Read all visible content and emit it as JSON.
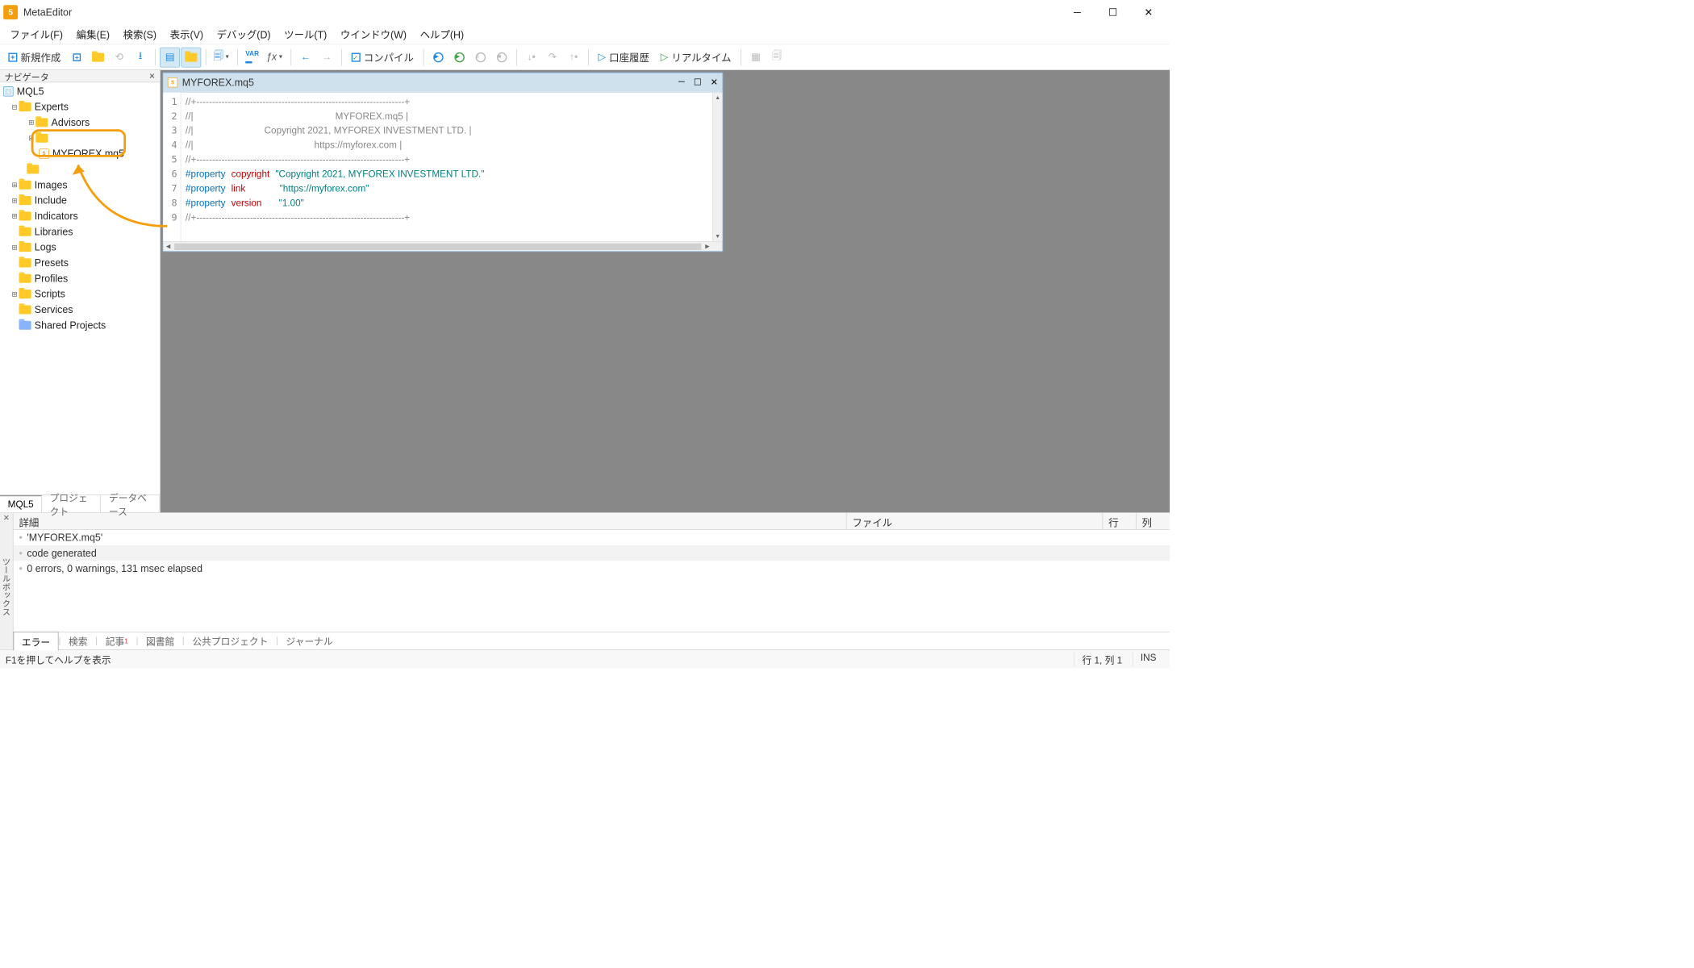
{
  "title": "MetaEditor",
  "menu": [
    "ファイル(F)",
    "編集(E)",
    "検索(S)",
    "表示(V)",
    "デバッグ(D)",
    "ツール(T)",
    "ウインドウ(W)",
    "ヘルプ(H)"
  ],
  "toolbar": {
    "new": "新規作成",
    "compile": "コンパイル",
    "history": "口座履歴",
    "realtime": "リアルタイム"
  },
  "navigator": {
    "title": "ナビゲータ",
    "root": "MQL5",
    "nodes": {
      "experts": "Experts",
      "advisors": "Advisors",
      "highlighted_file": "MYFOREX.mq5",
      "images": "Images",
      "include": "Include",
      "indicators": "Indicators",
      "libraries": "Libraries",
      "logs": "Logs",
      "presets": "Presets",
      "profiles": "Profiles",
      "scripts": "Scripts",
      "services": "Services",
      "shared": "Shared Projects"
    },
    "tabs": [
      "MQL5",
      "プロジェクト",
      "データベース"
    ]
  },
  "editor": {
    "filename": "MYFOREX.mq5",
    "lines": {
      "l1": "//+------------------------------------------------------------------+",
      "l2_pre": "//|",
      "l2_txt": "                                                      MYFOREX.mq5 |",
      "l3_pre": "//|",
      "l3_txt": "                           Copyright 2021, MYFOREX INVESTMENT LTD. |",
      "l4_pre": "//|",
      "l4_txt": "                                              https://myforex.com |",
      "l5": "//+------------------------------------------------------------------+",
      "l6_kw": "#property",
      "l6_attr": "copyright",
      "l6_val": "\"Copyright 2021, MYFOREX INVESTMENT LTD.\"",
      "l7_kw": "#property",
      "l7_attr": "link",
      "l7_val": "\"https://myforex.com\"",
      "l8_kw": "#property",
      "l8_attr": "version",
      "l8_val": "\"1.00\"",
      "l9": "//+------------------------------------------------------------------+"
    }
  },
  "bottom": {
    "label": "ツールボックス",
    "cols": {
      "detail": "詳細",
      "file": "ファイル",
      "row": "行",
      "col": "列"
    },
    "rows": [
      "'MYFOREX.mq5'",
      "code generated",
      "0 errors, 0 warnings, 131 msec elapsed"
    ],
    "tabs": [
      "エラー",
      "検索",
      "記事",
      "図書館",
      "公共プロジェクト",
      "ジャーナル"
    ]
  },
  "status": {
    "help": "F1を押してヘルプを表示",
    "pos": "行 1, 列 1",
    "mode": "INS"
  }
}
